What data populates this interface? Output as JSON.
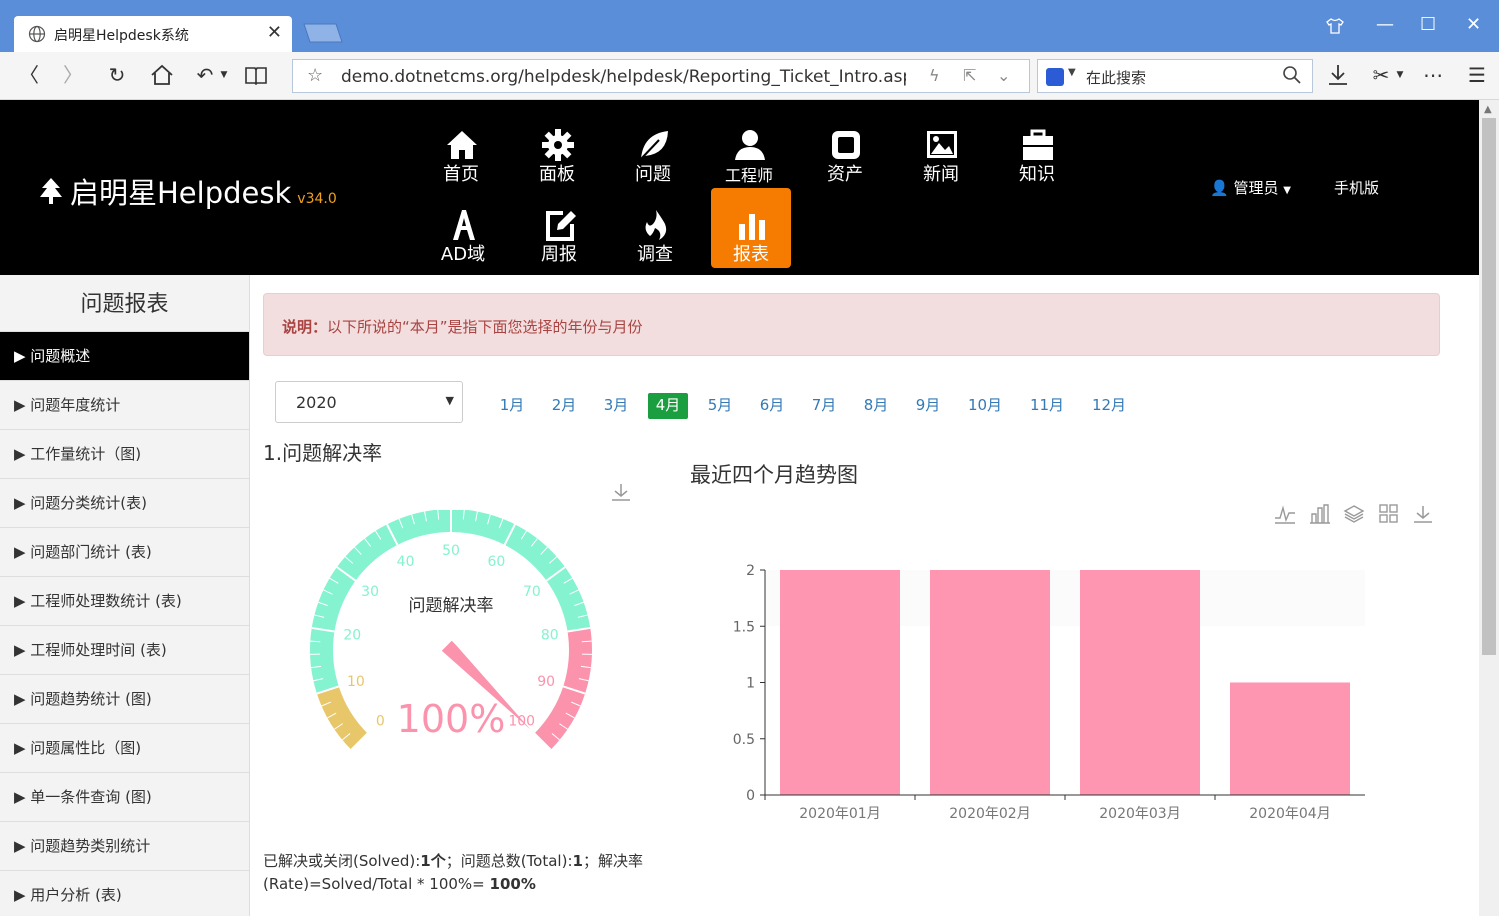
{
  "browser": {
    "tab_title": "启明星Helpdesk系统",
    "url": "demo.dotnetcms.org/helpdesk/helpdesk/Reporting_Ticket_Intro.asp",
    "search_placeholder": "在此搜索"
  },
  "header": {
    "logo_text": "启明星Helpdesk",
    "version": "v34.0",
    "nav": [
      {
        "label": "首页",
        "icon": "home-icon"
      },
      {
        "label": "面板",
        "icon": "gear-icon"
      },
      {
        "label": "问题",
        "icon": "leaf-icon"
      },
      {
        "label": "工程师",
        "icon": "user-icon"
      },
      {
        "label": "资产",
        "icon": "square-icon"
      },
      {
        "label": "新闻",
        "icon": "picture-icon"
      },
      {
        "label": "知识",
        "icon": "briefcase-icon"
      },
      {
        "label": "AD域",
        "icon": "font-icon"
      },
      {
        "label": "周报",
        "icon": "edit-icon"
      },
      {
        "label": "调查",
        "icon": "fire-icon"
      },
      {
        "label": "报表",
        "icon": "bar-chart-icon",
        "active": true
      }
    ],
    "user": "管理员",
    "mobile": "手机版"
  },
  "sidebar": {
    "title": "问题报表",
    "items": [
      "▶ 问题概述",
      "▶ 问题年度统计",
      "▶ 工作量统计（图)",
      "▶ 问题分类统计(表)",
      "▶ 问题部门统计 (表)",
      "▶ 工程师处理数统计 (表)",
      "▶ 工程师处理时间 (表)",
      "▶ 问题趋势统计 (图)",
      "▶ 问题属性比（图)",
      "▶ 单一条件查询 (图)",
      "▶ 问题趋势类别统计",
      "▶ 用户分析 (表)"
    ],
    "active_index": 0
  },
  "notice": {
    "label": "说明：",
    "text": "以下所说的“本月”是指下面您选择的年份与月份"
  },
  "filter": {
    "year": "2020",
    "months": [
      "1月",
      "2月",
      "3月",
      "4月",
      "5月",
      "6月",
      "7月",
      "8月",
      "9月",
      "10月",
      "11月",
      "12月"
    ],
    "selected_month_index": 3
  },
  "gauge": {
    "section_title": "1.问题解决率",
    "name": "问题解决率",
    "value": 100,
    "value_text": "100%",
    "min": 0,
    "max": 100,
    "tick_labels": [
      "0",
      "10",
      "20",
      "30",
      "40",
      "50",
      "60",
      "70",
      "80",
      "90",
      "100"
    ],
    "colors": {
      "low": "#e8c76a",
      "mid": "#85f2d0",
      "high": "#fb93ad"
    }
  },
  "stats": {
    "solved_label": "已解决或关闭(Solved):",
    "solved_value": "1个",
    "total_label": "；问题总数(Total):",
    "total_value": "1",
    "rate_label": "；解决率 (Rate)=Solved/Total * 100%=",
    "rate_value": "100%"
  },
  "chart_data": {
    "type": "bar",
    "title": "最近四个月趋势图",
    "categories": [
      "2020年01月",
      "2020年02月",
      "2020年03月",
      "2020年04月"
    ],
    "values": [
      2,
      2,
      2,
      1
    ],
    "ylim": [
      0,
      2
    ],
    "yticks": [
      "0",
      "0.5",
      "1",
      "1.5",
      "2"
    ],
    "color": "#ff96b1",
    "grid": false
  }
}
